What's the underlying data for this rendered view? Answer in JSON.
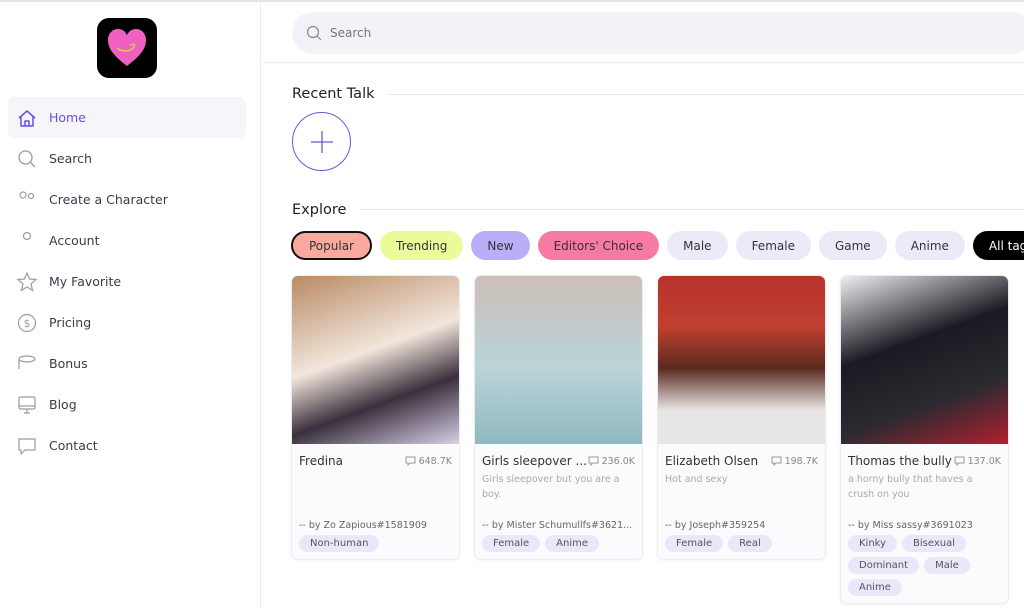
{
  "sidebar": {
    "items": [
      {
        "label": "Home",
        "icon": "home-icon",
        "active": true
      },
      {
        "label": "Search",
        "icon": "search-icon"
      },
      {
        "label": "Create a Character",
        "icon": "users-icon"
      },
      {
        "label": "Account",
        "icon": "user-icon"
      },
      {
        "label": "My Favorite",
        "icon": "star-icon"
      },
      {
        "label": "Pricing",
        "icon": "dollar-icon"
      },
      {
        "label": "Bonus",
        "icon": "coins-icon"
      },
      {
        "label": "Blog",
        "icon": "monitor-icon"
      },
      {
        "label": "Contact",
        "icon": "chat-icon"
      }
    ]
  },
  "search": {
    "placeholder": "Search"
  },
  "recent": {
    "title": "Recent Talk"
  },
  "explore": {
    "title": "Explore",
    "tags": [
      {
        "label": "Popular",
        "color": "#f9a99e",
        "selected": true
      },
      {
        "label": "Trending",
        "color": "#eafc9a"
      },
      {
        "label": "New",
        "color": "#b9aef8"
      },
      {
        "label": "Editors' Choice",
        "color": "#f77aa5"
      },
      {
        "label": "Male",
        "color": "#eceaf8"
      },
      {
        "label": "Female",
        "color": "#eceaf8"
      },
      {
        "label": "Game",
        "color": "#eceaf8"
      },
      {
        "label": "Anime",
        "color": "#eceaf8"
      },
      {
        "label": "All tags",
        "color": "#000000"
      }
    ]
  },
  "cards": [
    {
      "name": "Fredina",
      "count": "648.7K",
      "desc": "",
      "author": "-- by Zo Zapious#1581909",
      "tags": [
        "Non-human"
      ]
    },
    {
      "name": "Girls sleepover ...",
      "count": "236.0K",
      "desc": "Girls sleepover but you are a boy.",
      "author": "-- by Mister Schumullfs#3621...",
      "tags": [
        "Female",
        "Anime"
      ]
    },
    {
      "name": "Elizabeth Olsen",
      "count": "198.7K",
      "desc": "Hot and sexy",
      "author": "-- by Joseph#359254",
      "tags": [
        "Female",
        "Real"
      ]
    },
    {
      "name": "Thomas the bully",
      "count": "137.0K",
      "desc": "a horny bully that haves a crush on you",
      "author": "-- by Miss sassy#3691023",
      "tags": [
        "Kinky",
        "Bisexual",
        "Dominant",
        "Male",
        "Anime"
      ]
    }
  ],
  "colors": {
    "accent": "#6a4ee6",
    "logo_heart": "#f060c0"
  }
}
